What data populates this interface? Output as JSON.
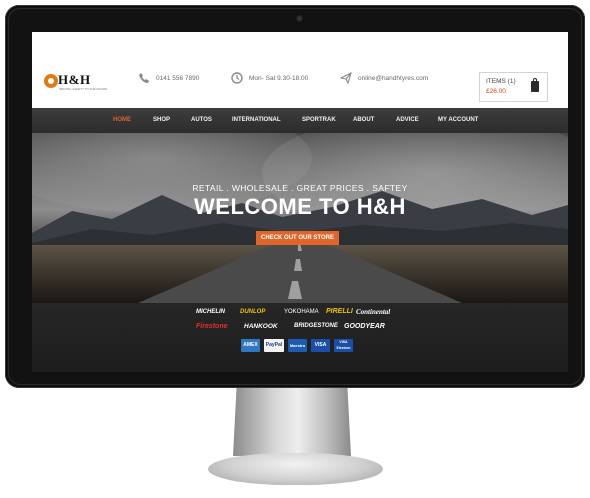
{
  "header": {
    "logo_text": "H&H",
    "logo_tagline": "DRIVING SAFETY TO THE ROADS",
    "phone": "0141 556 7890",
    "hours": "Mon- Sat 9.30-18.00",
    "email": "online@handhtyres.com"
  },
  "cart": {
    "label": "ITEMS (1)",
    "price": "£26.00"
  },
  "nav": {
    "items": [
      "HOME",
      "SHOP",
      "AUTOS",
      "INTERNATIONAL",
      "SPORTRAK",
      "ABOUT",
      "ADVICE",
      "MY ACCOUNT"
    ],
    "active": "HOME"
  },
  "hero": {
    "subtitle": "RETAIL . WHOLESALE . GREAT PRICES . SAFTEY",
    "title": "WELCOME TO H&H",
    "cta": "CHECK OUT OUR STORE"
  },
  "brands": {
    "row1": [
      "MICHELIN",
      "DUNLOP",
      "YOKOHAMA",
      "PIRELLI",
      "Continental"
    ],
    "row2": [
      "Firestone",
      "HANKOOK",
      "BRIDGESTONE",
      "GOODYEAR"
    ]
  },
  "payments": [
    "AMEX",
    "PayPal",
    "Maestro",
    "VISA",
    "VISA Electron"
  ],
  "colors": {
    "accent": "#e0652a",
    "nav_bg": "#333333",
    "footer_bg": "#222222"
  },
  "icons": {
    "phone": "phone-icon",
    "clock": "clock-icon",
    "mail": "paper-plane-icon",
    "cart": "shopping-bag-icon"
  }
}
